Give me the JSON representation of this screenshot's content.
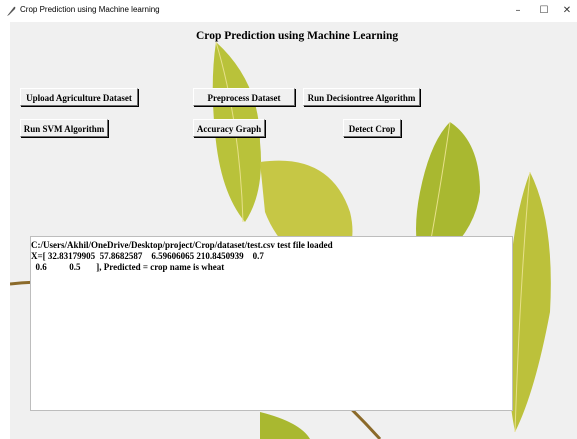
{
  "window": {
    "title": "Crop  Prediction using Machine learning",
    "controls": {
      "minimize": "–",
      "maximize": "☐",
      "close": "✕"
    }
  },
  "heading": "Crop  Prediction using Machine Learning",
  "buttons": {
    "upload": "Upload Agriculture Dataset",
    "preprocess": "Preprocess Dataset",
    "decision_tree": "Run Decisiontree Algorithm",
    "svm": "Run SVM Algorithm",
    "accuracy": "Accuracy Graph",
    "detect": "Detect Crop"
  },
  "output": {
    "lines": [
      "C:/Users/Akhil/OneDrive/Desktop/project/Crop/dataset/test.csv test file loaded",
      "X=[ 32.83179905  57.8682587    6.59606065 210.8450939    0.7",
      "  0.6          0.5       ], Predicted = crop name is wheat"
    ]
  },
  "colors": {
    "leaf": "#a8b82e",
    "leaf_light": "#d9d65a",
    "stem": "#8b6a2a"
  }
}
